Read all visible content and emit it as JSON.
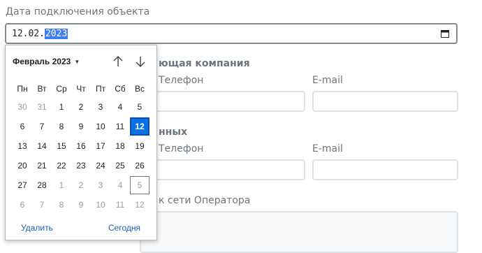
{
  "form": {
    "connection_date_label": "Дата подключения объекта",
    "connection_date": {
      "day": "12",
      "month": "02",
      "year": "2023"
    },
    "section_company": "ющая компания",
    "section_data": "нных",
    "phone_label": "Телефон",
    "email_label": "E-mail",
    "operator_label": "к сети Оператора"
  },
  "calendar": {
    "month_label": "Февраль 2023",
    "weekdays": [
      "Пн",
      "Вт",
      "Ср",
      "Чт",
      "Пт",
      "Сб",
      "Вс"
    ],
    "weeks": [
      [
        "30",
        "31",
        "1",
        "2",
        "3",
        "4",
        "5"
      ],
      [
        "6",
        "7",
        "8",
        "9",
        "10",
        "11",
        "12"
      ],
      [
        "13",
        "14",
        "15",
        "16",
        "17",
        "18",
        "19"
      ],
      [
        "20",
        "21",
        "22",
        "23",
        "24",
        "25",
        "26"
      ],
      [
        "27",
        "28",
        "1",
        "2",
        "3",
        "4",
        "5"
      ],
      [
        "6",
        "7",
        "8",
        "9",
        "10",
        "11",
        "12"
      ]
    ],
    "clear_label": "Удалить",
    "today_label": "Сегодня"
  }
}
